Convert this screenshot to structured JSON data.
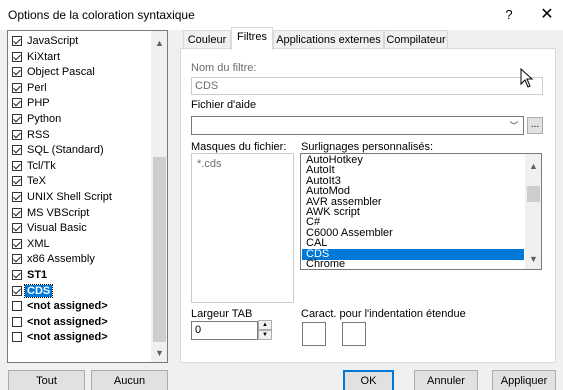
{
  "window": {
    "title": "Options de la coloration syntaxique",
    "help": "?",
    "close": "✕"
  },
  "languages": [
    {
      "label": "JavaScript",
      "checked": true,
      "bold": false,
      "selected": false
    },
    {
      "label": "KiXtart",
      "checked": true,
      "bold": false,
      "selected": false
    },
    {
      "label": "Object Pascal",
      "checked": true,
      "bold": false,
      "selected": false
    },
    {
      "label": "Perl",
      "checked": true,
      "bold": false,
      "selected": false
    },
    {
      "label": "PHP",
      "checked": true,
      "bold": false,
      "selected": false
    },
    {
      "label": "Python",
      "checked": true,
      "bold": false,
      "selected": false
    },
    {
      "label": "RSS",
      "checked": true,
      "bold": false,
      "selected": false
    },
    {
      "label": "SQL (Standard)",
      "checked": true,
      "bold": false,
      "selected": false
    },
    {
      "label": "Tcl/Tk",
      "checked": true,
      "bold": false,
      "selected": false
    },
    {
      "label": "TeX",
      "checked": true,
      "bold": false,
      "selected": false
    },
    {
      "label": "UNIX Shell Script",
      "checked": true,
      "bold": false,
      "selected": false
    },
    {
      "label": "MS VBScript",
      "checked": true,
      "bold": false,
      "selected": false
    },
    {
      "label": "Visual Basic",
      "checked": true,
      "bold": false,
      "selected": false
    },
    {
      "label": "XML",
      "checked": true,
      "bold": false,
      "selected": false
    },
    {
      "label": "x86 Assembly",
      "checked": true,
      "bold": false,
      "selected": false
    },
    {
      "label": "ST1",
      "checked": true,
      "bold": true,
      "selected": false
    },
    {
      "label": "CDS",
      "checked": true,
      "bold": true,
      "selected": true
    },
    {
      "label": "<not assigned>",
      "checked": false,
      "bold": true,
      "selected": false
    },
    {
      "label": "<not assigned>",
      "checked": false,
      "bold": true,
      "selected": false
    },
    {
      "label": "<not assigned>",
      "checked": false,
      "bold": true,
      "selected": false
    }
  ],
  "tabs": [
    {
      "label": "Couleur",
      "active": false
    },
    {
      "label": "Filtres",
      "active": true
    },
    {
      "label": "Applications externes",
      "active": false
    },
    {
      "label": "Compilateur",
      "active": false
    }
  ],
  "filtres": {
    "filter_name_label": "Nom du filtre:",
    "filter_name_value": "CDS",
    "help_file_label": "Fichier d'aide",
    "help_file_value": "",
    "browse_label": "...",
    "masks_label": "Masques du fichier:",
    "mask_value": "*.cds",
    "highlights_label": "Surlignages personnalisés:",
    "highlights": [
      "AutoHotkey",
      "AutoIt",
      "AutoIt3",
      "AutoMod",
      "AVR assembler",
      "AWK script",
      "C#",
      "C6000 Assembler",
      "CAL",
      "CDS",
      "Chrome"
    ],
    "highlight_selected": "CDS",
    "tab_width_label": "Largeur TAB",
    "tab_width_value": "0",
    "indent_chars_label": "Caract. pour l'indentation étendue"
  },
  "buttons": {
    "all": "Tout",
    "none": "Aucun",
    "ok": "OK",
    "cancel": "Annuler",
    "apply": "Appliquer"
  },
  "colors": {
    "accent": "#0078d7"
  }
}
